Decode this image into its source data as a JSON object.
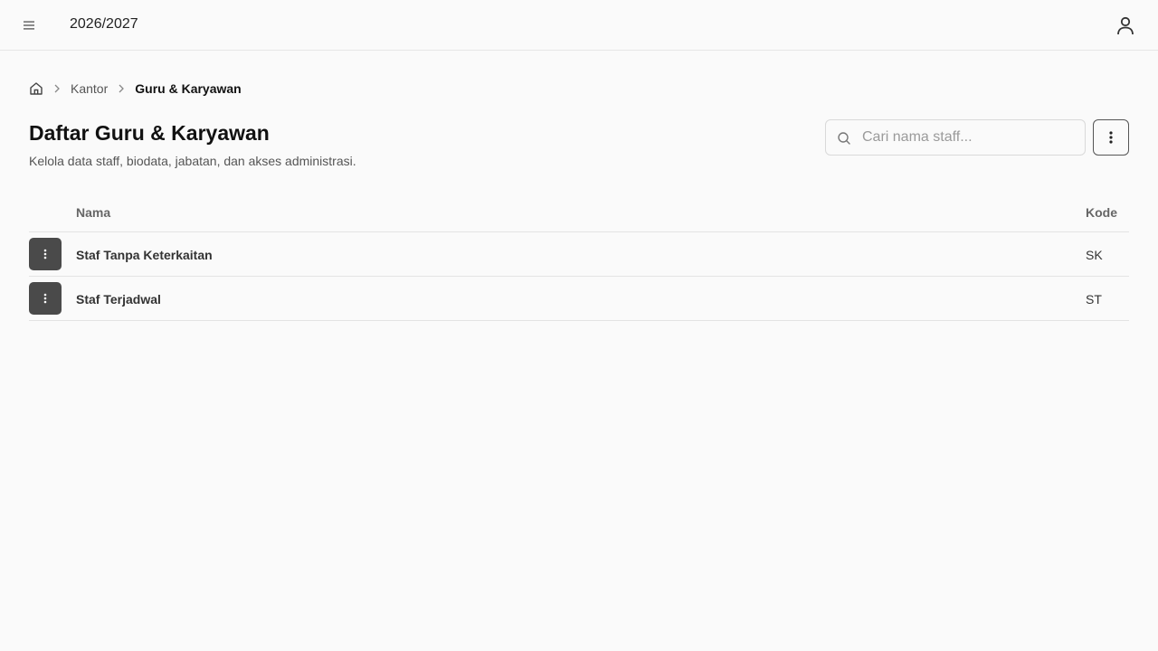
{
  "header": {
    "menu_icon": "hamburger-icon",
    "academic_year": "2026/2027",
    "user_icon": "user-icon"
  },
  "breadcrumb": {
    "home_icon": "home-icon",
    "items": [
      {
        "label": "Kantor"
      },
      {
        "label": "Guru & Karyawan"
      }
    ]
  },
  "page": {
    "title": "Daftar Guru & Karyawan",
    "subtitle": "Kelola data staff, biodata, jabatan, dan akses administrasi."
  },
  "search": {
    "placeholder": "Cari nama staff...",
    "value": ""
  },
  "table": {
    "columns": {
      "name": "Nama",
      "code": "Kode"
    },
    "rows": [
      {
        "name": "Staf Tanpa Keterkaitan",
        "code": "SK"
      },
      {
        "name": "Staf Terjadwal",
        "code": "ST"
      }
    ]
  },
  "colors": {
    "background": "#fafafa",
    "row_action": "#4a4a4a",
    "border": "#e3e3e3"
  }
}
